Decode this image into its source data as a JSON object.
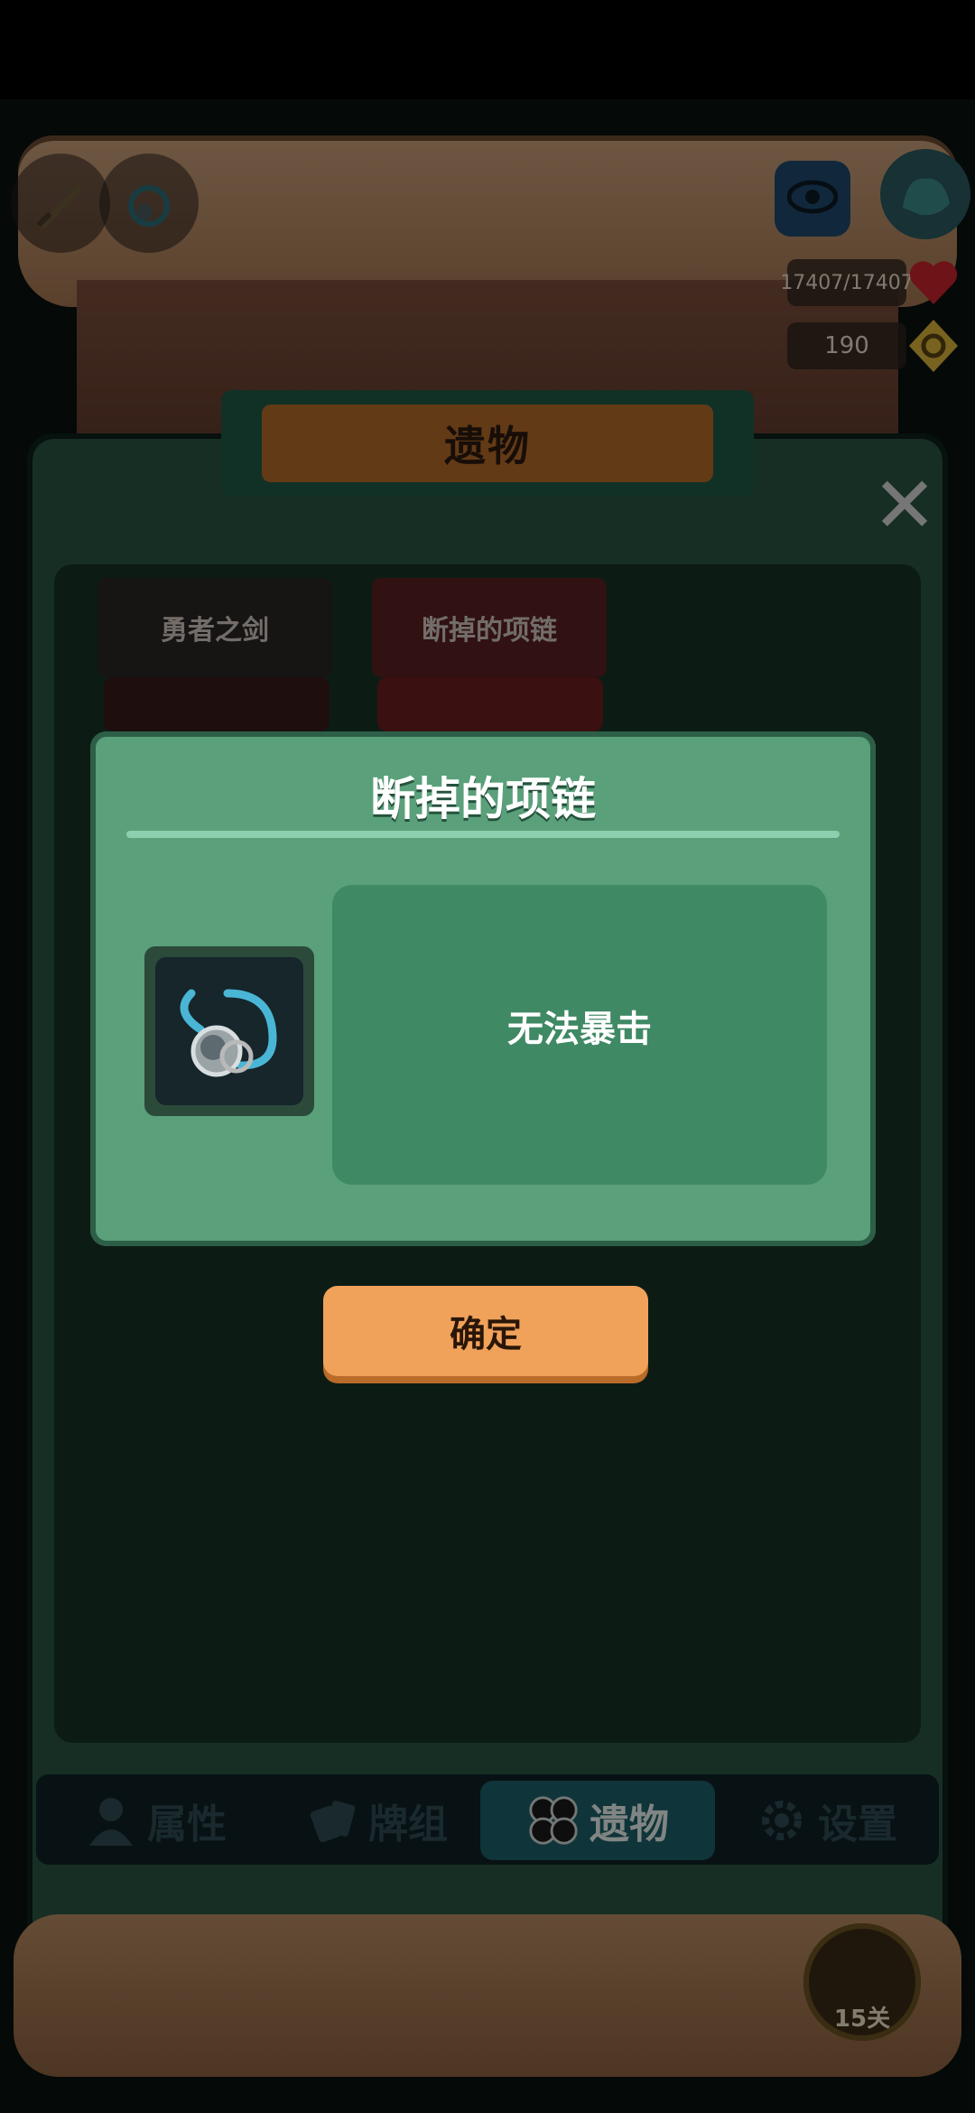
{
  "hud": {
    "hp": "17407/17407",
    "gold": "190",
    "hp_color": "#c8232c",
    "gold_color": "#d9b23a"
  },
  "panel": {
    "title": "遗物",
    "relics": [
      {
        "name": "勇者之剑"
      },
      {
        "name": "断掉的项链"
      }
    ]
  },
  "dialog": {
    "title": "断掉的项链",
    "description": "无法暴击",
    "confirm_label": "确定",
    "item_icon": "broken-necklace-icon"
  },
  "tabs": [
    {
      "label": "属性",
      "icon": "person-icon",
      "active": false
    },
    {
      "label": "牌组",
      "icon": "cards-icon",
      "active": false
    },
    {
      "label": "遗物",
      "icon": "clover-icon",
      "active": true
    },
    {
      "label": "设置",
      "icon": "gear-icon",
      "active": false
    }
  ],
  "level": {
    "label": "15关"
  },
  "colors": {
    "panel_green": "#2a5543",
    "dialog_green": "#5aa07a",
    "button_orange": "#f0a25a",
    "active_tab": "#1d5f68"
  }
}
